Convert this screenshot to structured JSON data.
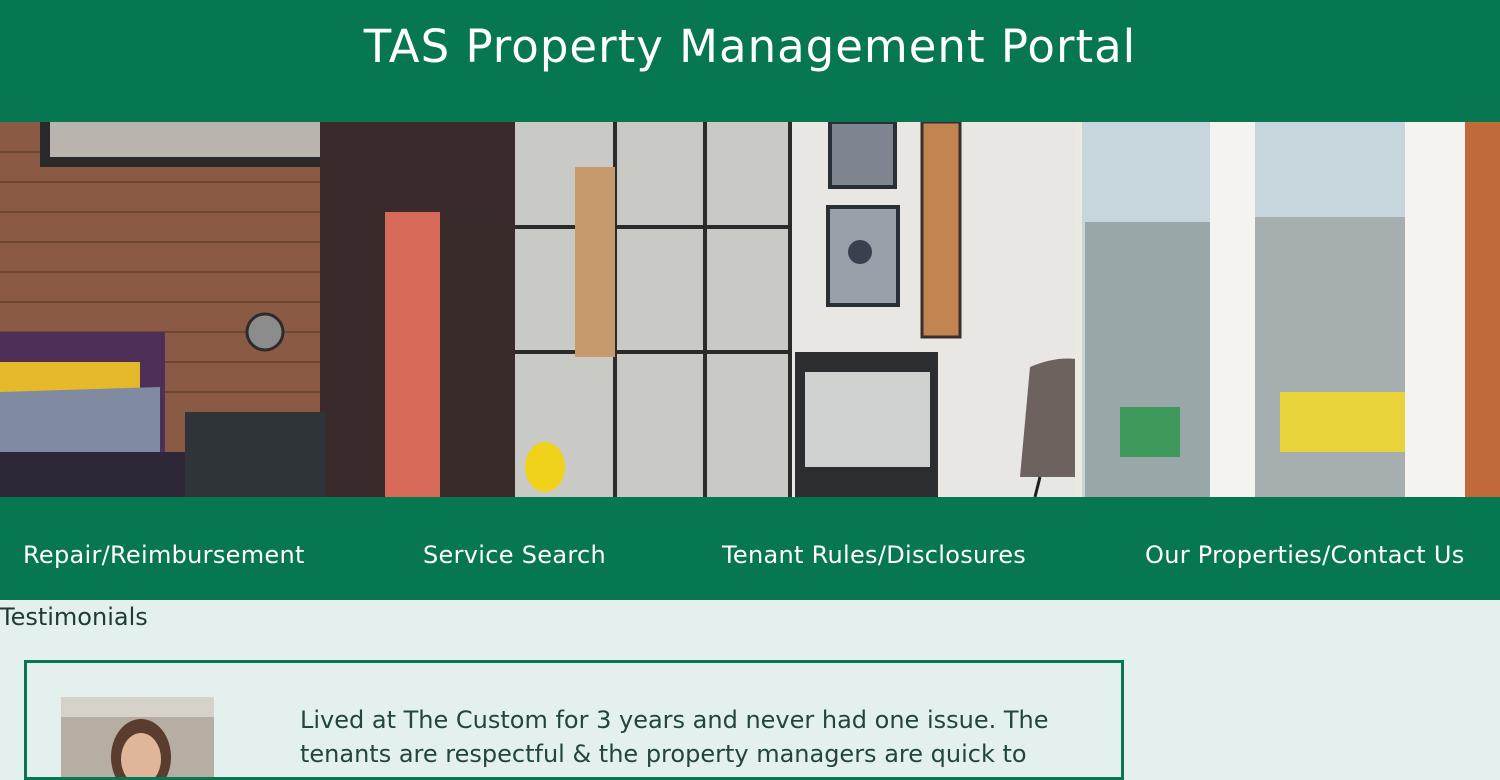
{
  "header": {
    "title": "TAS Property Management Portal"
  },
  "hero": {
    "image": "apartment-interior-photo"
  },
  "nav": {
    "items": [
      {
        "label": "Repair/Reimbursement"
      },
      {
        "label": "Service Search"
      },
      {
        "label": "Tenant Rules/Disclosures"
      },
      {
        "label": "Our Properties/Contact Us"
      }
    ]
  },
  "testimonials": {
    "title": "Testimonials",
    "items": [
      {
        "text": "Lived at The Custom for 3 years and never had one issue. The tenants are respectful & the property managers are quick to"
      }
    ]
  },
  "colors": {
    "brand": "#077752",
    "background": "#e4f0ee",
    "text": "#1f3b34"
  }
}
